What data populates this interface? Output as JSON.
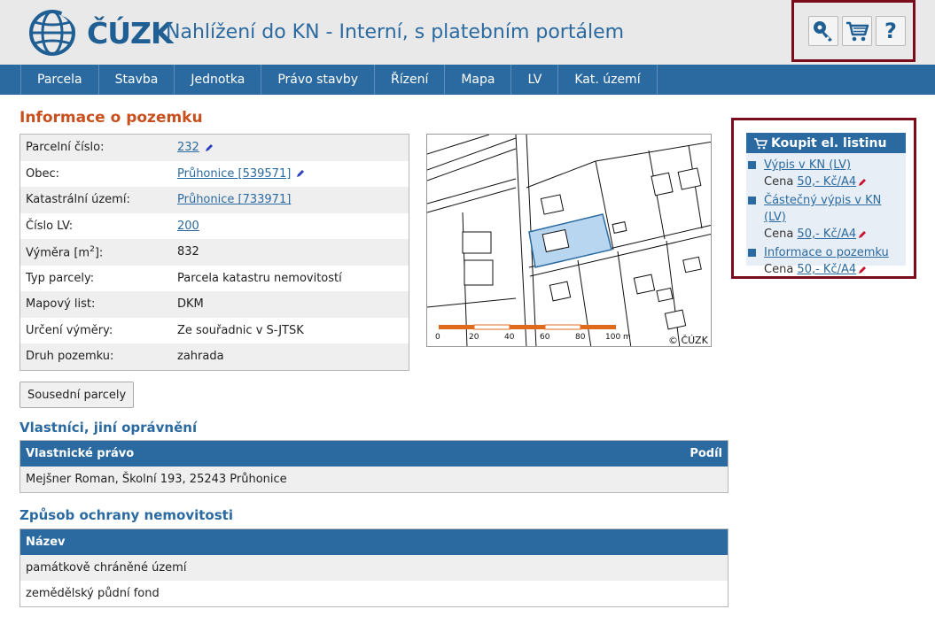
{
  "header": {
    "logo_text": "ČÚZK",
    "title": "Nahlížení do KN - Interní, s platebním portálem",
    "tools": [
      {
        "icon": "key-icon"
      },
      {
        "icon": "cart-icon"
      },
      {
        "icon": "help-icon",
        "glyph": "?"
      }
    ]
  },
  "nav": {
    "items": [
      {
        "label": "Parcela"
      },
      {
        "label": "Stavba"
      },
      {
        "label": "Jednotka"
      },
      {
        "label": "Právo stavby"
      },
      {
        "label": "Řízení"
      },
      {
        "label": "Mapa"
      },
      {
        "label": "LV"
      },
      {
        "label": "Kat. území"
      }
    ]
  },
  "info": {
    "title": "Informace o pozemku",
    "rows": {
      "parcelni": {
        "label": "Parcelní číslo:",
        "value": "232"
      },
      "obec": {
        "label": "Obec:",
        "value": "Průhonice [539571]"
      },
      "ku": {
        "label": "Katastrální území:",
        "value": "Průhonice [733971]"
      },
      "lv": {
        "label": "Číslo LV:",
        "value": "200"
      },
      "vymera": {
        "label_main": "Výměra [m",
        "label_sup": "2",
        "label_end": "]:",
        "value": "832"
      },
      "typ": {
        "label": "Typ parcely:",
        "value": "Parcela katastru nemovitostí"
      },
      "mapovy": {
        "label": "Mapový list:",
        "value": "DKM"
      },
      "urceni": {
        "label": "Určení výměry:",
        "value": "Ze souřadnic v S-JTSK"
      },
      "druh": {
        "label": "Druh pozemku:",
        "value": "zahrada"
      }
    }
  },
  "map": {
    "scale_labels": [
      "0",
      "20",
      "40",
      "60",
      "80",
      "100 m"
    ],
    "copyright": "© ČÚZK"
  },
  "buy": {
    "title": "Koupit el. listinu",
    "items": [
      {
        "label": "Výpis v KN (LV)",
        "price_prefix": "Cena ",
        "price": "50,- Kč/A4"
      },
      {
        "label": "Částečný výpis v KN (LV)",
        "price_prefix": "Cena ",
        "price": "50,- Kč/A4"
      },
      {
        "label": "Informace o pozemku",
        "price_prefix": "Cena ",
        "price": "50,- Kč/A4"
      }
    ]
  },
  "buttons": {
    "neighbors": "Sousední parcely"
  },
  "owners": {
    "title": "Vlastníci, jiní oprávnění",
    "col_left": "Vlastnické právo",
    "col_right": "Podíl",
    "rows": [
      {
        "text": "Mejšner Roman, Školní 193, 25243 Průhonice"
      }
    ]
  },
  "protection": {
    "title": "Způsob ochrany nemovitosti",
    "col": "Název",
    "rows": [
      {
        "text": "památkově chráněné území"
      },
      {
        "text": "zemědělský půdní fond"
      }
    ]
  },
  "colors": {
    "brand_blue": "#2a6aa0",
    "accent_orange": "#c8501e",
    "highlight_frame": "#7a0c1e"
  }
}
